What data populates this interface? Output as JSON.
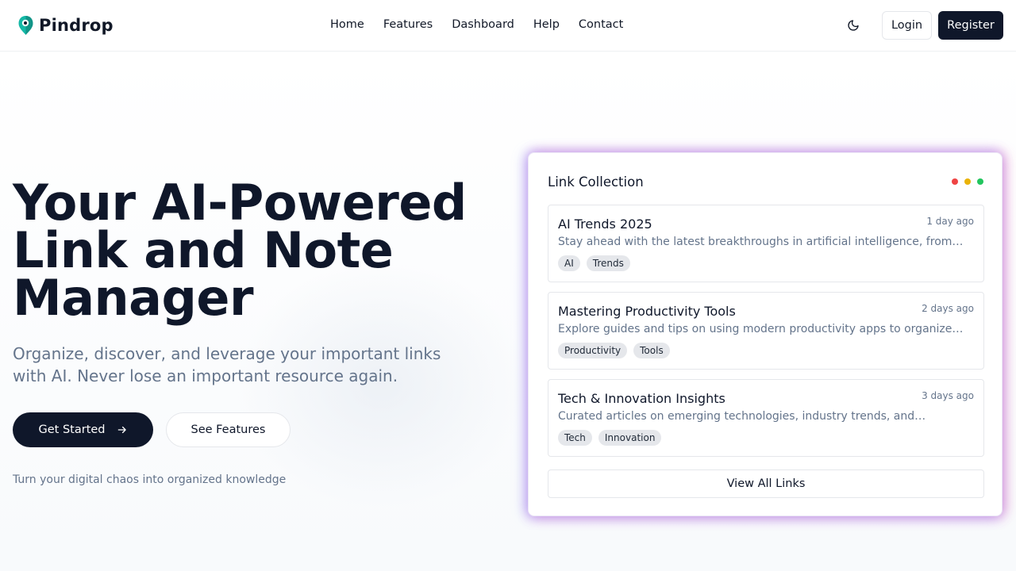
{
  "header": {
    "brand": "Pindrop",
    "nav": [
      "Home",
      "Features",
      "Dashboard",
      "Help",
      "Contact"
    ],
    "login_label": "Login",
    "register_label": "Register"
  },
  "hero": {
    "title": "Your AI-Powered Link and Note Manager",
    "subtitle": "Organize, discover, and leverage your important links with AI. Never lose an important resource again.",
    "primary_cta": "Get Started",
    "secondary_cta": "See Features",
    "note": "Turn your digital chaos into organized knowledge"
  },
  "card": {
    "title": "Link Collection",
    "dots": [
      "#ef4444",
      "#eab308",
      "#22c55e"
    ],
    "items": [
      {
        "title": "AI Trends 2025",
        "time": "1 day ago",
        "desc": "Stay ahead with the latest breakthroughs in artificial intelligence, from…",
        "tags": [
          "AI",
          "Trends"
        ]
      },
      {
        "title": "Mastering Productivity Tools",
        "time": "2 days ago",
        "desc": "Explore guides and tips on using modern productivity apps to organize…",
        "tags": [
          "Productivity",
          "Tools"
        ]
      },
      {
        "title": "Tech & Innovation Insights",
        "time": "3 days ago",
        "desc": "Curated articles on emerging technologies, industry trends, and…",
        "tags": [
          "Tech",
          "Innovation"
        ]
      }
    ],
    "view_all_label": "View All Links"
  },
  "colors": {
    "primary": "#0f172a",
    "muted_text": "#64748b",
    "logo_teal": "#14b8a6"
  },
  "icons": {
    "logo": "pin-logo-icon",
    "theme_toggle": "moon-icon",
    "cta_arrow": "arrow-right-icon"
  }
}
